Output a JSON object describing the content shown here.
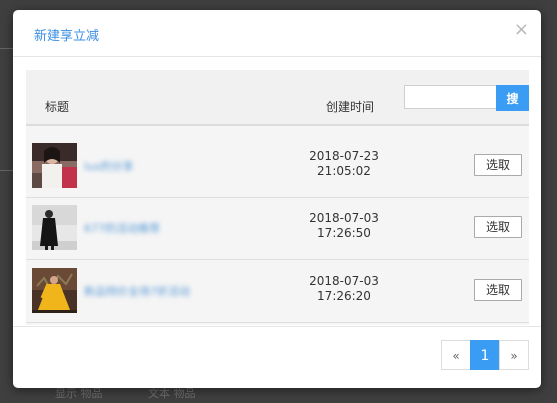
{
  "background": {
    "ghost_texts": [
      "显示 物品",
      "文本 物品"
    ]
  },
  "modal": {
    "title": "新建享立减",
    "close_glyph": "×"
  },
  "table": {
    "col_title": "标题",
    "col_time": "创建时间",
    "search": {
      "value": "",
      "button_label": "搜"
    },
    "rows": [
      {
        "title": "lux的分享",
        "date": "2018-07-23",
        "time": "21:05:02",
        "select_label": "选取"
      },
      {
        "title": "677的活动推荐",
        "date": "2018-07-03",
        "time": "17:26:50",
        "select_label": "选取"
      },
      {
        "title": "新品特价全场7折活动",
        "date": "2018-07-03",
        "time": "17:26:20",
        "select_label": "选取"
      }
    ]
  },
  "pagination": {
    "prev": "«",
    "current": "1",
    "next": "»"
  },
  "colors": {
    "accent": "#3a9cf3",
    "title": "#3a8ee6"
  }
}
